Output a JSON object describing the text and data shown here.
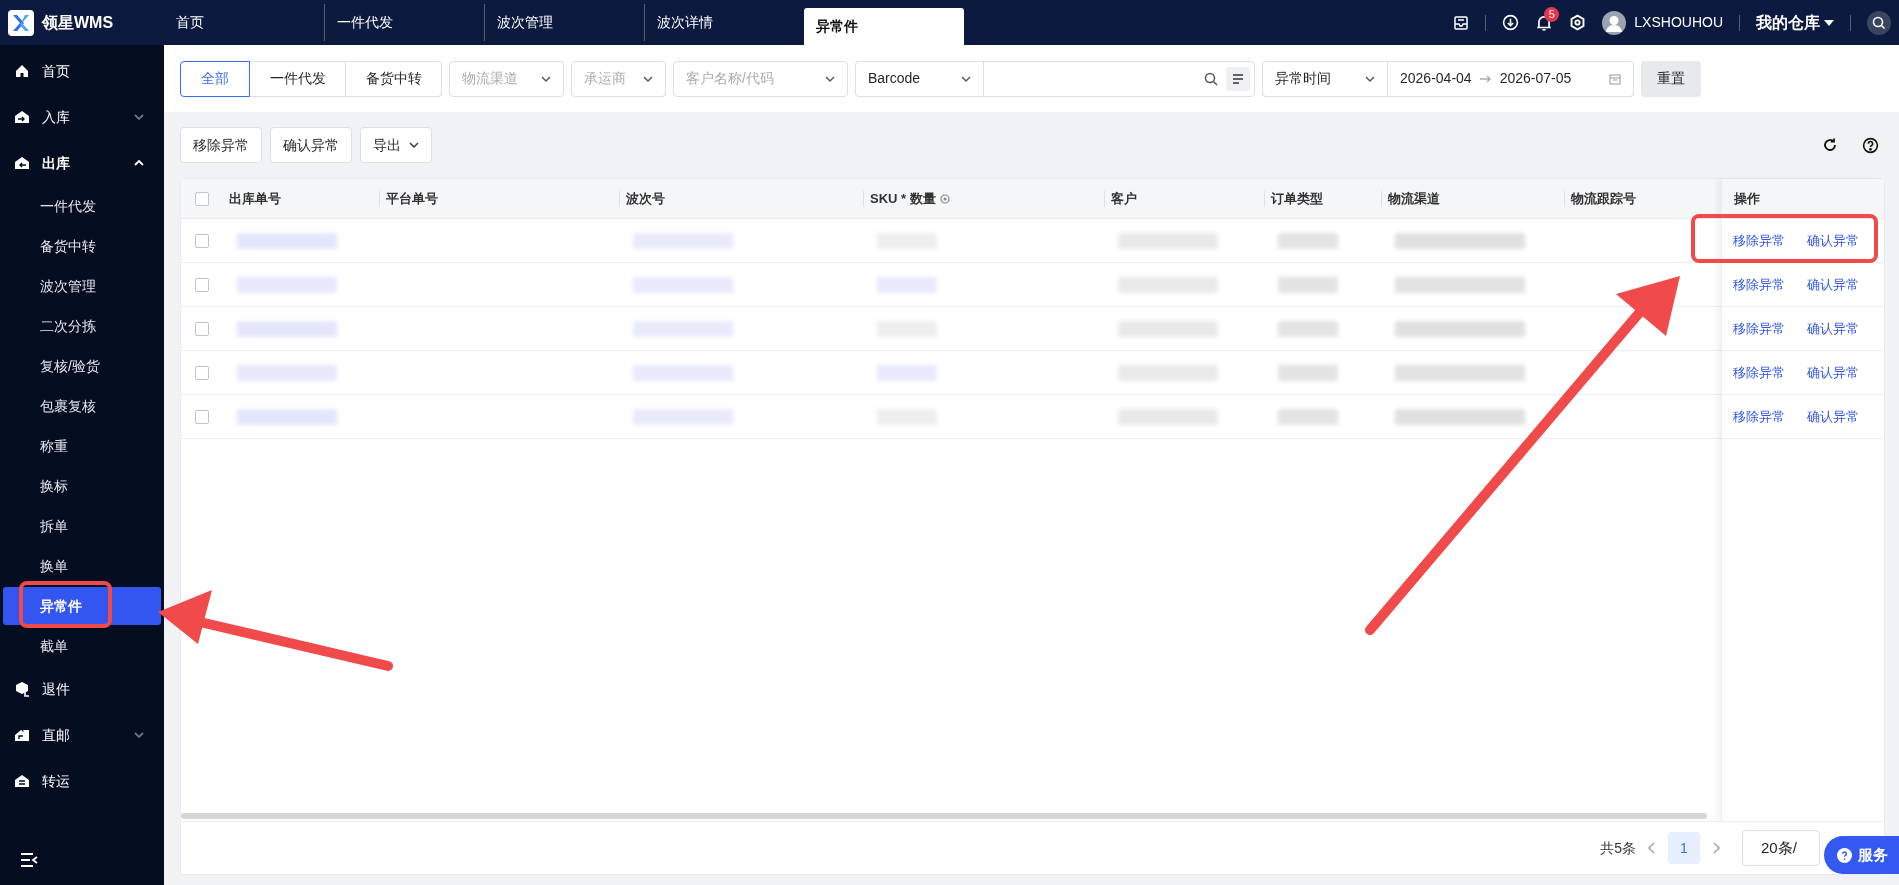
{
  "app": {
    "title": "领星WMS"
  },
  "top_tabs": [
    {
      "label": "首页",
      "selected": false
    },
    {
      "label": "一件代发",
      "selected": false
    },
    {
      "label": "波次管理",
      "selected": false
    },
    {
      "label": "波次详情",
      "selected": false
    },
    {
      "label": "异常件",
      "selected": true
    }
  ],
  "header": {
    "notification_count": "5",
    "user": "LXSHOUHOU",
    "warehouse": "我的仓库"
  },
  "sidebar": {
    "items": [
      {
        "label": "首页",
        "kind": "link"
      },
      {
        "label": "入库",
        "kind": "group",
        "expanded": false
      },
      {
        "label": "出库",
        "kind": "group",
        "expanded": true,
        "children": [
          {
            "label": "一件代发",
            "selected": false
          },
          {
            "label": "备货中转",
            "selected": false
          },
          {
            "label": "波次管理",
            "selected": false
          },
          {
            "label": "二次分拣",
            "selected": false
          },
          {
            "label": "复核/验货",
            "selected": false
          },
          {
            "label": "包裹复核",
            "selected": false
          },
          {
            "label": "称重",
            "selected": false
          },
          {
            "label": "换标",
            "selected": false
          },
          {
            "label": "拆单",
            "selected": false
          },
          {
            "label": "换单",
            "selected": false
          },
          {
            "label": "异常件",
            "selected": true
          },
          {
            "label": "截单",
            "selected": false
          }
        ]
      },
      {
        "label": "退件",
        "kind": "link"
      },
      {
        "label": "直邮",
        "kind": "group",
        "expanded": false
      },
      {
        "label": "转运",
        "kind": "link"
      }
    ]
  },
  "filters": {
    "segments": [
      {
        "label": "全部",
        "selected": true
      },
      {
        "label": "一件代发",
        "selected": false
      },
      {
        "label": "备货中转",
        "selected": false
      }
    ],
    "selects": [
      {
        "placeholder": "物流渠道"
      },
      {
        "placeholder": "承运商"
      },
      {
        "placeholder": "客户名称/代码"
      }
    ],
    "search_type": "Barcode",
    "time_type": "异常时间",
    "date_start": "2026-04-04",
    "date_end": "2026-07-05",
    "reset": "重置"
  },
  "toolbar": {
    "buttons": [
      "移除异常",
      "确认异常"
    ],
    "export": "导出"
  },
  "table": {
    "select_all_checked": false,
    "columns": [
      "出库单号",
      "平台单号",
      "波次号",
      "SKU * 数量",
      "客户",
      "订单类型",
      "物流渠道",
      "物流跟踪号",
      "操作"
    ],
    "rows": [
      {
        "checked": false,
        "actions": [
          "移除异常",
          "确认异常"
        ]
      },
      {
        "checked": false,
        "actions": [
          "移除异常",
          "确认异常"
        ]
      },
      {
        "checked": false,
        "actions": [
          "移除异常",
          "确认异常"
        ]
      },
      {
        "checked": false,
        "actions": [
          "移除异常",
          "确认异常"
        ]
      },
      {
        "checked": false,
        "actions": [
          "移除异常",
          "确认异常"
        ]
      }
    ]
  },
  "pagination": {
    "total": "共5条",
    "pages": [
      {
        "label": "1",
        "selected": true
      }
    ],
    "page_size": "20条/"
  },
  "service_button": {
    "label": "服务"
  }
}
